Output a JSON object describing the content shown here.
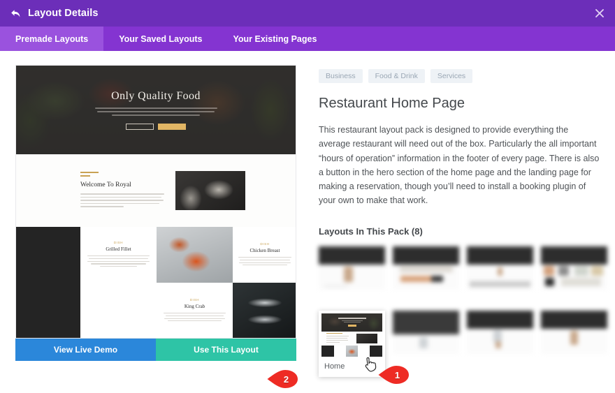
{
  "header": {
    "title": "Layout Details",
    "back_icon": "back-arrow-icon",
    "close_icon": "close-icon"
  },
  "tabs": [
    {
      "label": "Premade Layouts",
      "active": true
    },
    {
      "label": "Your Saved Layouts",
      "active": false
    },
    {
      "label": "Your Existing Pages",
      "active": false
    }
  ],
  "preview": {
    "hero": {
      "title": "Only Quality Food",
      "button_primary": "",
      "button_secondary": ""
    },
    "welcome": {
      "title": "Welcome To Royal"
    },
    "menu_cards": [
      {
        "tag": "DISH",
        "title": "Grilled Fillet"
      },
      {
        "tag": "DISH",
        "title": "Chicken Breast"
      },
      {
        "tag": "DISH",
        "title": "King Crab"
      }
    ],
    "actions": {
      "view_demo": "View Live Demo",
      "use_layout": "Use This Layout"
    }
  },
  "detail": {
    "categories": [
      "Business",
      "Food & Drink",
      "Services"
    ],
    "title": "Restaurant Home Page",
    "description": "This restaurant layout pack is designed to provide everything the average restaurant will need out of the box. Particularly the all important “hours of operation” information in the footer of every page. There is also a button in the hero section of the home page and the landing page for making a reservation, though you’ll need to install a booking plugin of your own to make that work.",
    "pack_heading": "Layouts In This Pack (8)",
    "layouts": [
      {
        "label": "",
        "selected": false
      },
      {
        "label": "",
        "selected": false
      },
      {
        "label": "",
        "selected": false
      },
      {
        "label": "",
        "selected": false
      },
      {
        "label": "Home",
        "selected": true
      },
      {
        "label": "",
        "selected": false
      },
      {
        "label": "",
        "selected": false
      },
      {
        "label": "",
        "selected": false
      }
    ]
  },
  "markers": [
    {
      "number": "1",
      "target": "home-layout-thumbnail"
    },
    {
      "number": "2",
      "target": "use-this-layout-button"
    }
  ],
  "colors": {
    "header_purple": "#6c2eb9",
    "tabbar_purple": "#8434d1",
    "tab_active_purple": "#9a52de",
    "demo_blue": "#2b87da",
    "use_teal": "#2ec4a6",
    "marker_red": "#ee2b24",
    "chip_bg": "#eef2f6",
    "text_dark": "#44484c"
  }
}
